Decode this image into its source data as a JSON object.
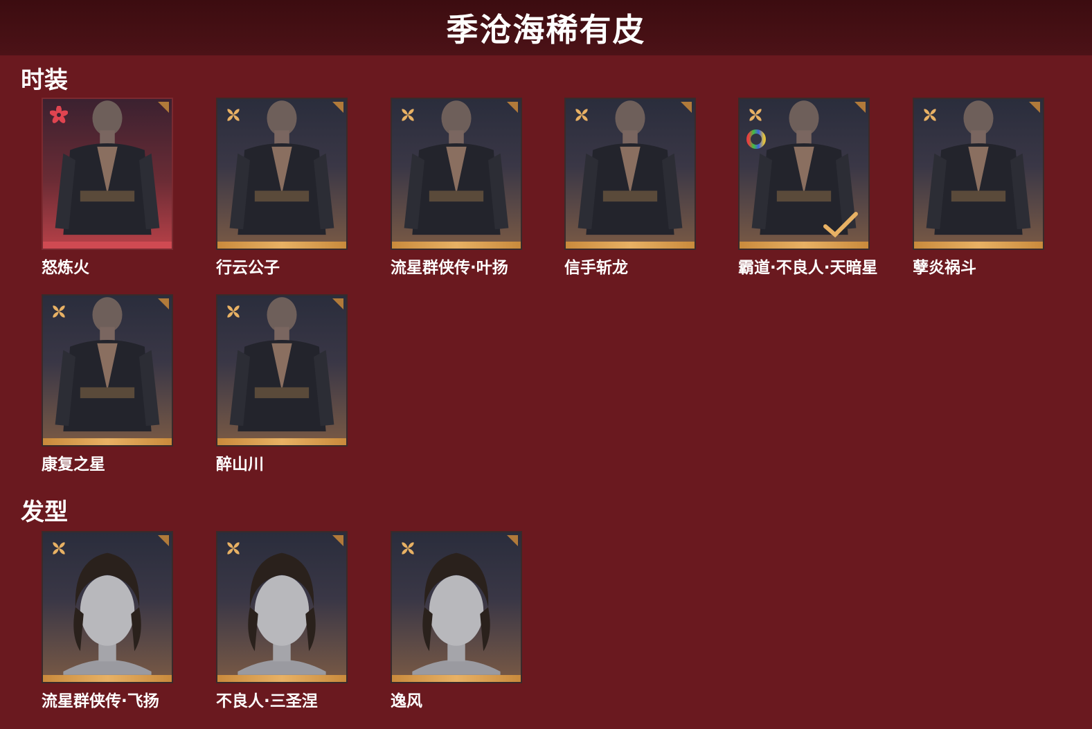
{
  "header": {
    "title": "季沧海稀有皮"
  },
  "sections": {
    "outfits": {
      "title": "时装",
      "items": [
        {
          "name": "怒炼火",
          "rarity": "red-flower-icon",
          "tier": "legendary"
        },
        {
          "name": "行云公子",
          "rarity": "gold-flower-icon",
          "tier": "rare"
        },
        {
          "name": "流星群侠传·叶扬",
          "rarity": "gold-flower-icon",
          "tier": "rare"
        },
        {
          "name": "信手斩龙",
          "rarity": "gold-flower-icon",
          "tier": "rare"
        },
        {
          "name": "霸道·不良人·天暗星",
          "rarity": "gold-flower-icon",
          "tier": "rare",
          "dye_ring": true,
          "owned_check": true
        },
        {
          "name": "孽炎祸斗",
          "rarity": "gold-flower-icon",
          "tier": "rare"
        },
        {
          "name": "康复之星",
          "rarity": "gold-flower-icon",
          "tier": "rare"
        },
        {
          "name": "醉山川",
          "rarity": "gold-flower-icon",
          "tier": "rare"
        }
      ]
    },
    "hair": {
      "title": "发型",
      "items": [
        {
          "name": "流星群侠传·飞扬",
          "rarity": "gold-flower-icon",
          "tier": "rare"
        },
        {
          "name": "不良人·三圣涅",
          "rarity": "gold-flower-icon",
          "tier": "rare"
        },
        {
          "name": "逸风",
          "rarity": "gold-flower-icon",
          "tier": "rare"
        }
      ]
    }
  },
  "colors": {
    "background": "#6a191f",
    "header": "#3c0c10",
    "gold": "#e8b164",
    "legendary": "#cf4a52"
  }
}
